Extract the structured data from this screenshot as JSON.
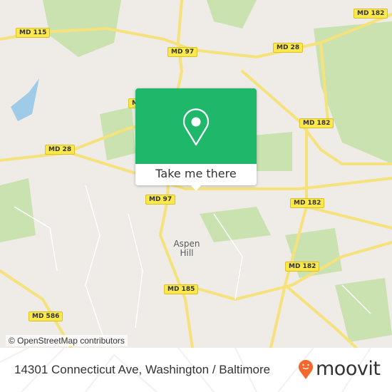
{
  "map": {
    "road_labels": [
      "MD 115",
      "MD 97",
      "MD 28",
      "MD 182",
      "MD",
      "MD 28",
      "MD 182",
      "MD 97",
      "MD 182",
      "MD 182",
      "MD 185",
      "MD 586"
    ],
    "place_label": "Aspen Hill",
    "attribution": "© OpenStreetMap contributors",
    "colors": {
      "land": "#efebe7",
      "park": "#c9e2b0",
      "water": "#9fcbe8",
      "road": "#f6e27a",
      "popup": "#1fb76a"
    }
  },
  "popup": {
    "icon": "location-pin-icon",
    "action_label": "Take me there"
  },
  "footer": {
    "address": "14301 Connecticut Ave, Washington / Baltimore",
    "brand": "moovit",
    "brand_color": "#f5672d"
  }
}
